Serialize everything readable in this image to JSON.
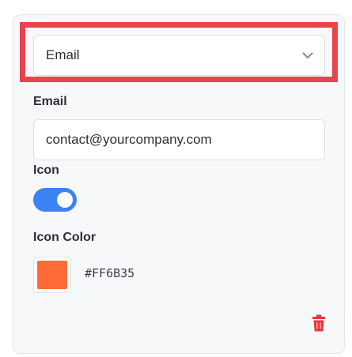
{
  "type_select": {
    "value": "Email",
    "icon": "chevron-down-icon"
  },
  "email": {
    "label": "Email",
    "value": "contact@yourcompany.com"
  },
  "icon": {
    "label": "Icon",
    "enabled": true
  },
  "icon_color": {
    "label": "Icon Color",
    "hex": "#FF6B35"
  },
  "actions": {
    "delete_icon": "trash-icon"
  },
  "colors": {
    "highlight_border": "#e8444b",
    "toggle_on": "#3b82f6",
    "swatch": "#FF6B35",
    "delete": "#e5383b"
  }
}
